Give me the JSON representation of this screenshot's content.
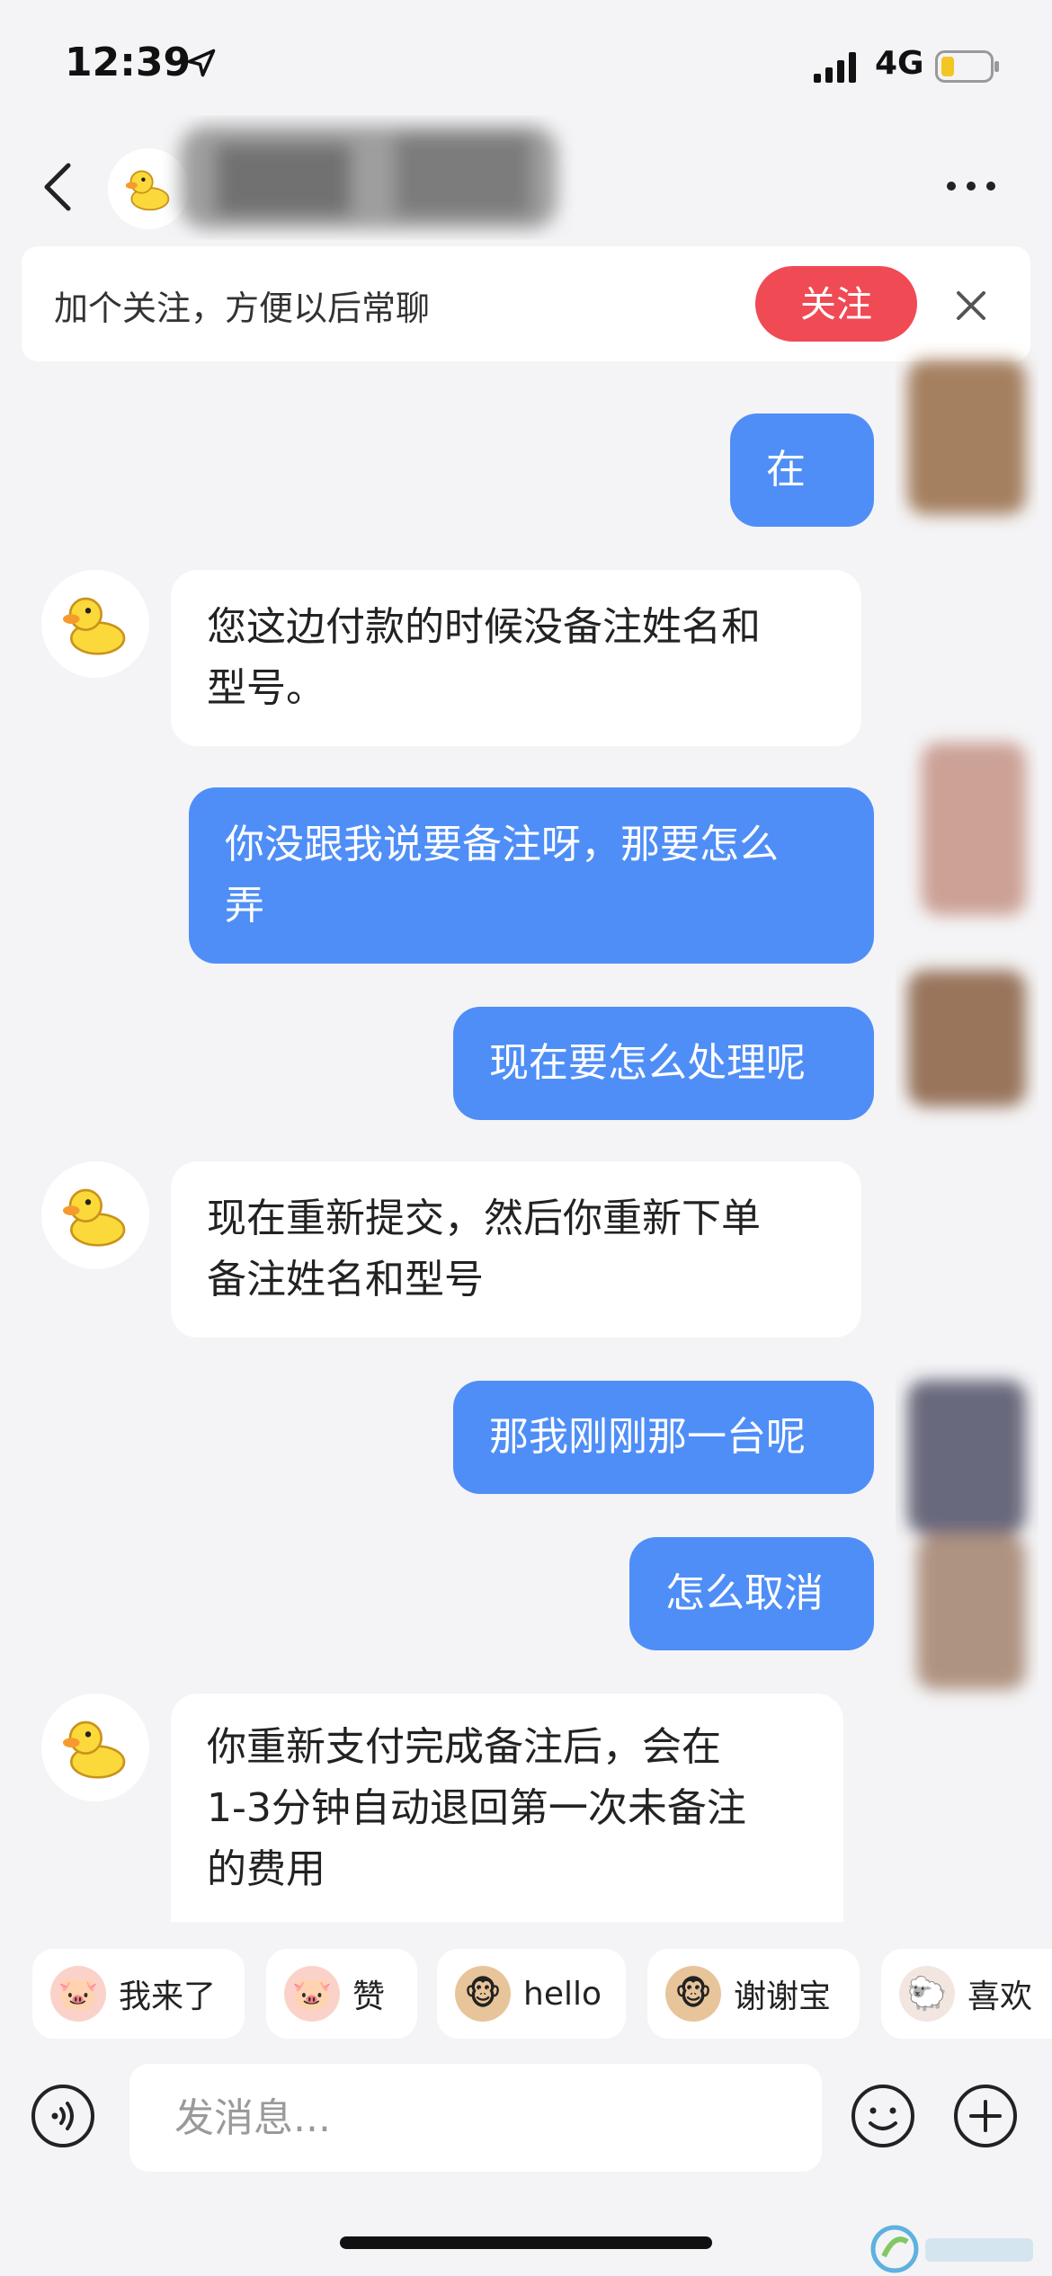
{
  "status": {
    "time": "12:39",
    "network": "4G"
  },
  "header": {
    "more_icon": "more-dots-icon",
    "back_icon": "chevron-left-icon"
  },
  "follow_banner": {
    "text": "加个关注，方便以后常聊",
    "button": "关注"
  },
  "messages": [
    {
      "from": "me",
      "lines": [
        "在"
      ]
    },
    {
      "from": "them",
      "lines": [
        "您这边付款的时候没备注姓名和",
        "型号。"
      ]
    },
    {
      "from": "me",
      "lines": [
        "你没跟我说要备注呀，那要怎么",
        "弄"
      ]
    },
    {
      "from": "me",
      "lines": [
        "现在要怎么处理呢"
      ]
    },
    {
      "from": "them",
      "lines": [
        "现在重新提交，然后你重新下单",
        "备注姓名和型号"
      ]
    },
    {
      "from": "me",
      "lines": [
        "那我刚刚那一台呢"
      ]
    },
    {
      "from": "me",
      "lines": [
        "怎么取消"
      ]
    },
    {
      "from": "them",
      "lines": [
        "你重新支付完成备注后，会在",
        "1-3分钟自动退回第一次未备注",
        "的费用"
      ]
    }
  ],
  "quick_replies": [
    "我来了",
    "赞",
    "hello",
    "谢谢宝",
    "喜欢"
  ],
  "input": {
    "placeholder": "发消息..."
  },
  "colors": {
    "bubble_me": "#4f8ef7",
    "follow_button": "#f04a55",
    "background": "#f4f4f6"
  }
}
